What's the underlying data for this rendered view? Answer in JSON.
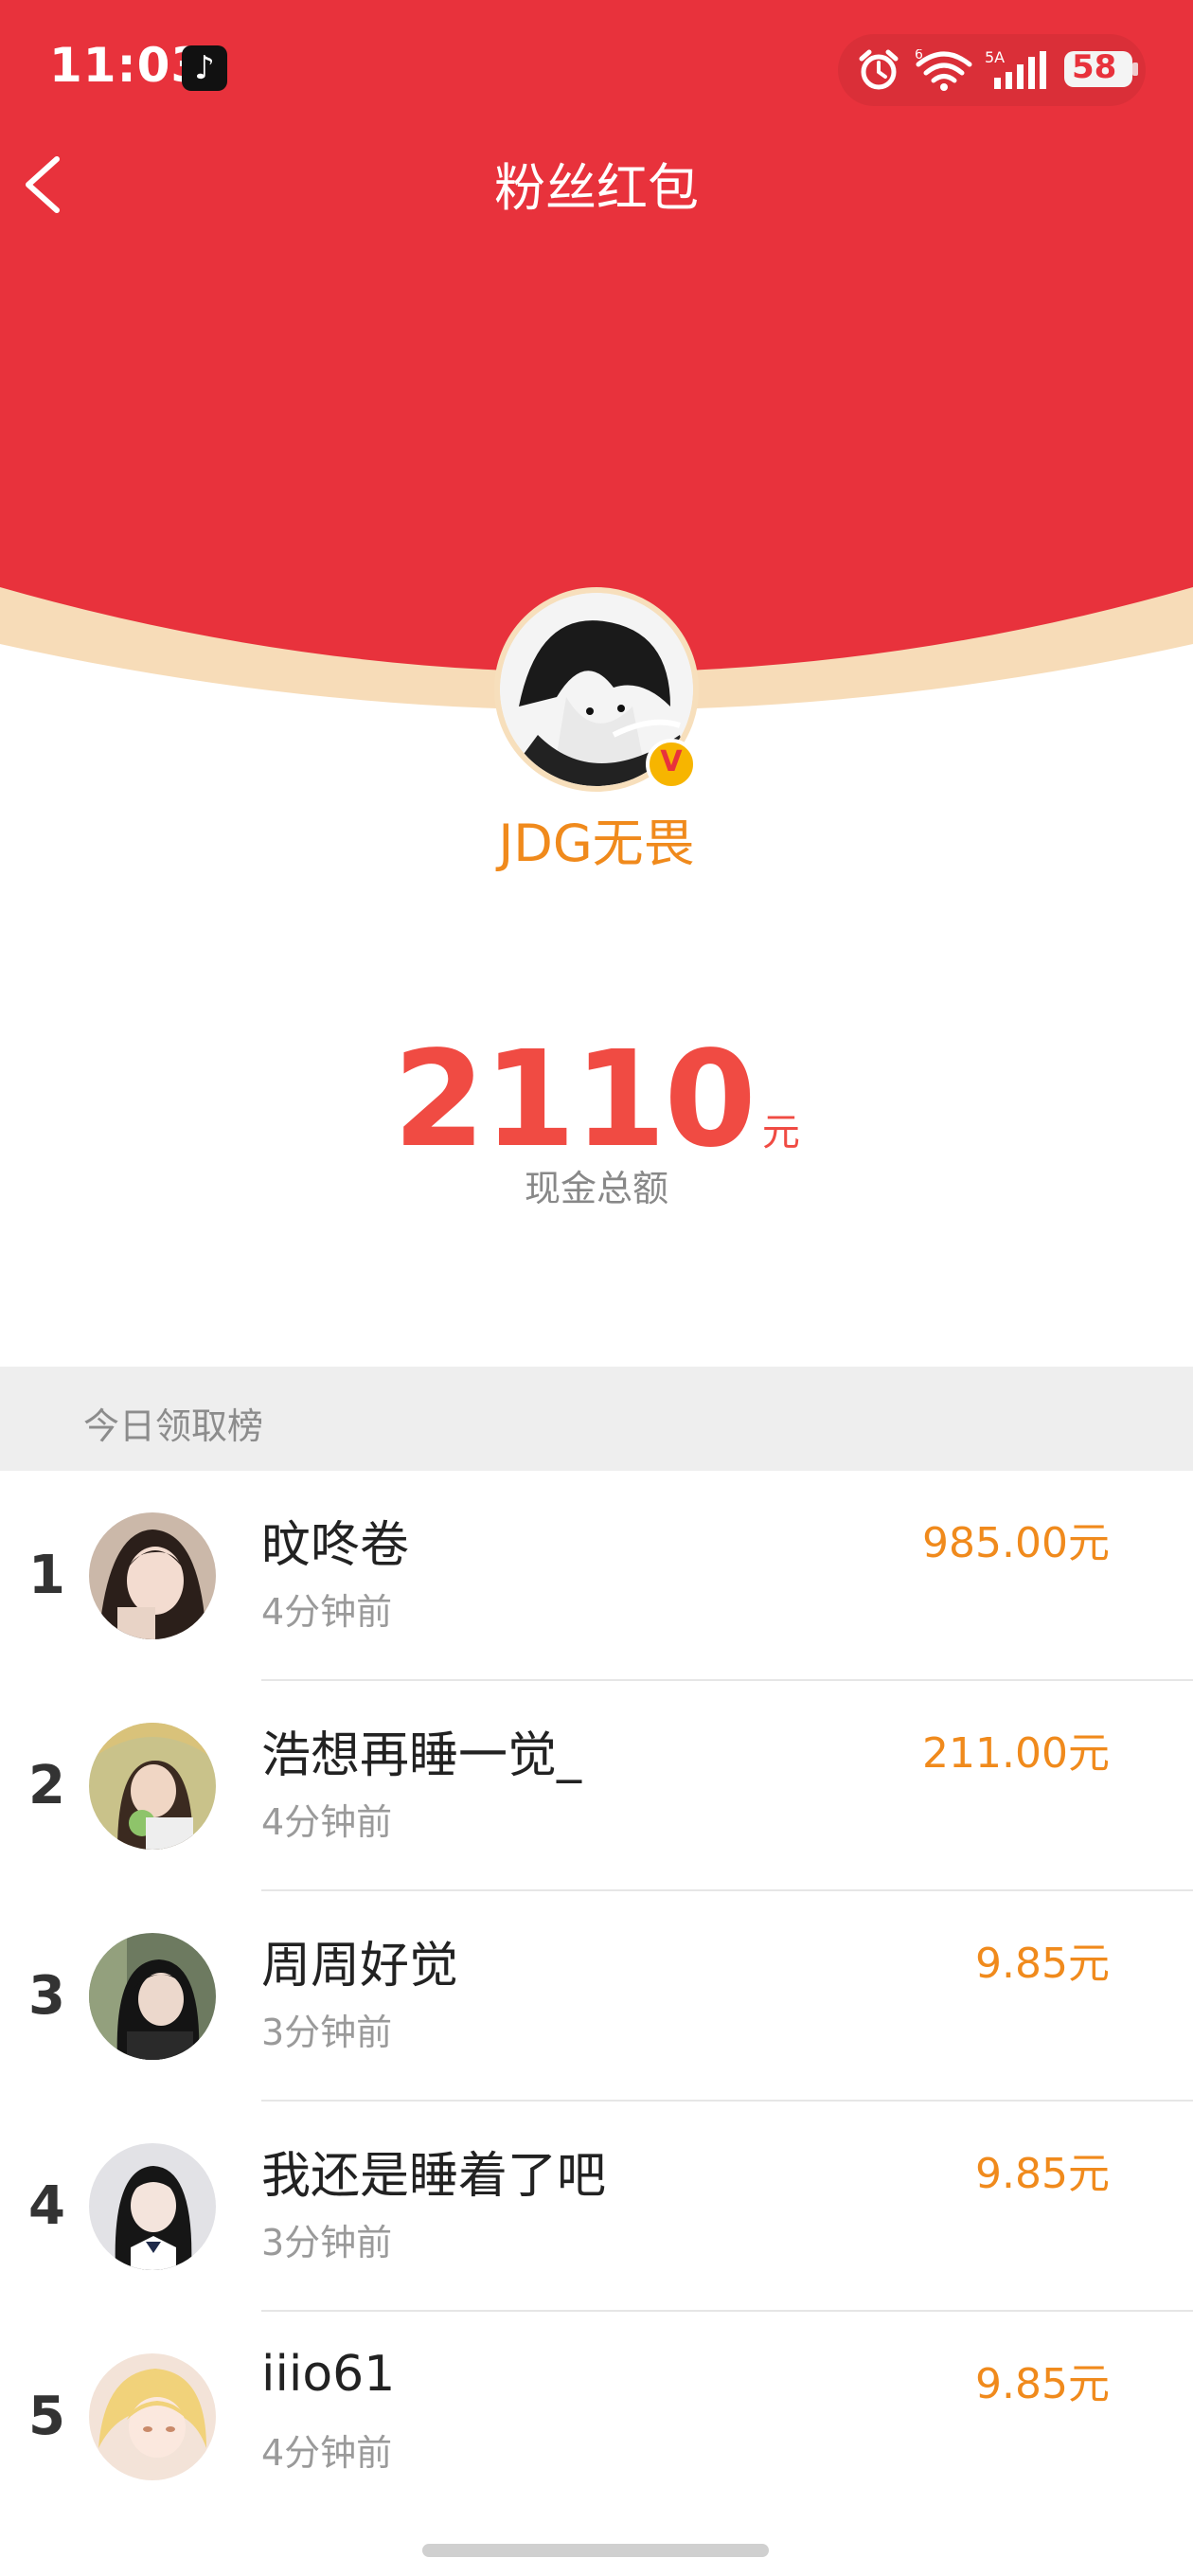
{
  "status_bar": {
    "time": "11:03",
    "app_badge": "tiktok-icon",
    "network": "5A",
    "wifi_label": "6",
    "battery": "58"
  },
  "nav": {
    "title": "粉丝红包"
  },
  "creator": {
    "name": "JDG无畏",
    "verified_badge": "V"
  },
  "cash": {
    "amount": "2110",
    "unit": "元",
    "label": "现金总额"
  },
  "leaderboard": {
    "title": "今日领取榜",
    "rows": [
      {
        "rank": "1",
        "name": "旼咚卷",
        "time": "4分钟前",
        "amount": "985.00元"
      },
      {
        "rank": "2",
        "name": "浩想再睡一觉_",
        "time": "4分钟前",
        "amount": "211.00元"
      },
      {
        "rank": "3",
        "name": "周周好觉",
        "time": "3分钟前",
        "amount": "9.85元"
      },
      {
        "rank": "4",
        "name": "我还是睡着了吧",
        "time": "3分钟前",
        "amount": "9.85元"
      },
      {
        "rank": "5",
        "name": "iiio61",
        "time": "4分钟前",
        "amount": "9.85元"
      }
    ]
  },
  "colors": {
    "header_red": "#E8323C",
    "gold": "#F08A1C",
    "amount_red": "#F04B43"
  }
}
